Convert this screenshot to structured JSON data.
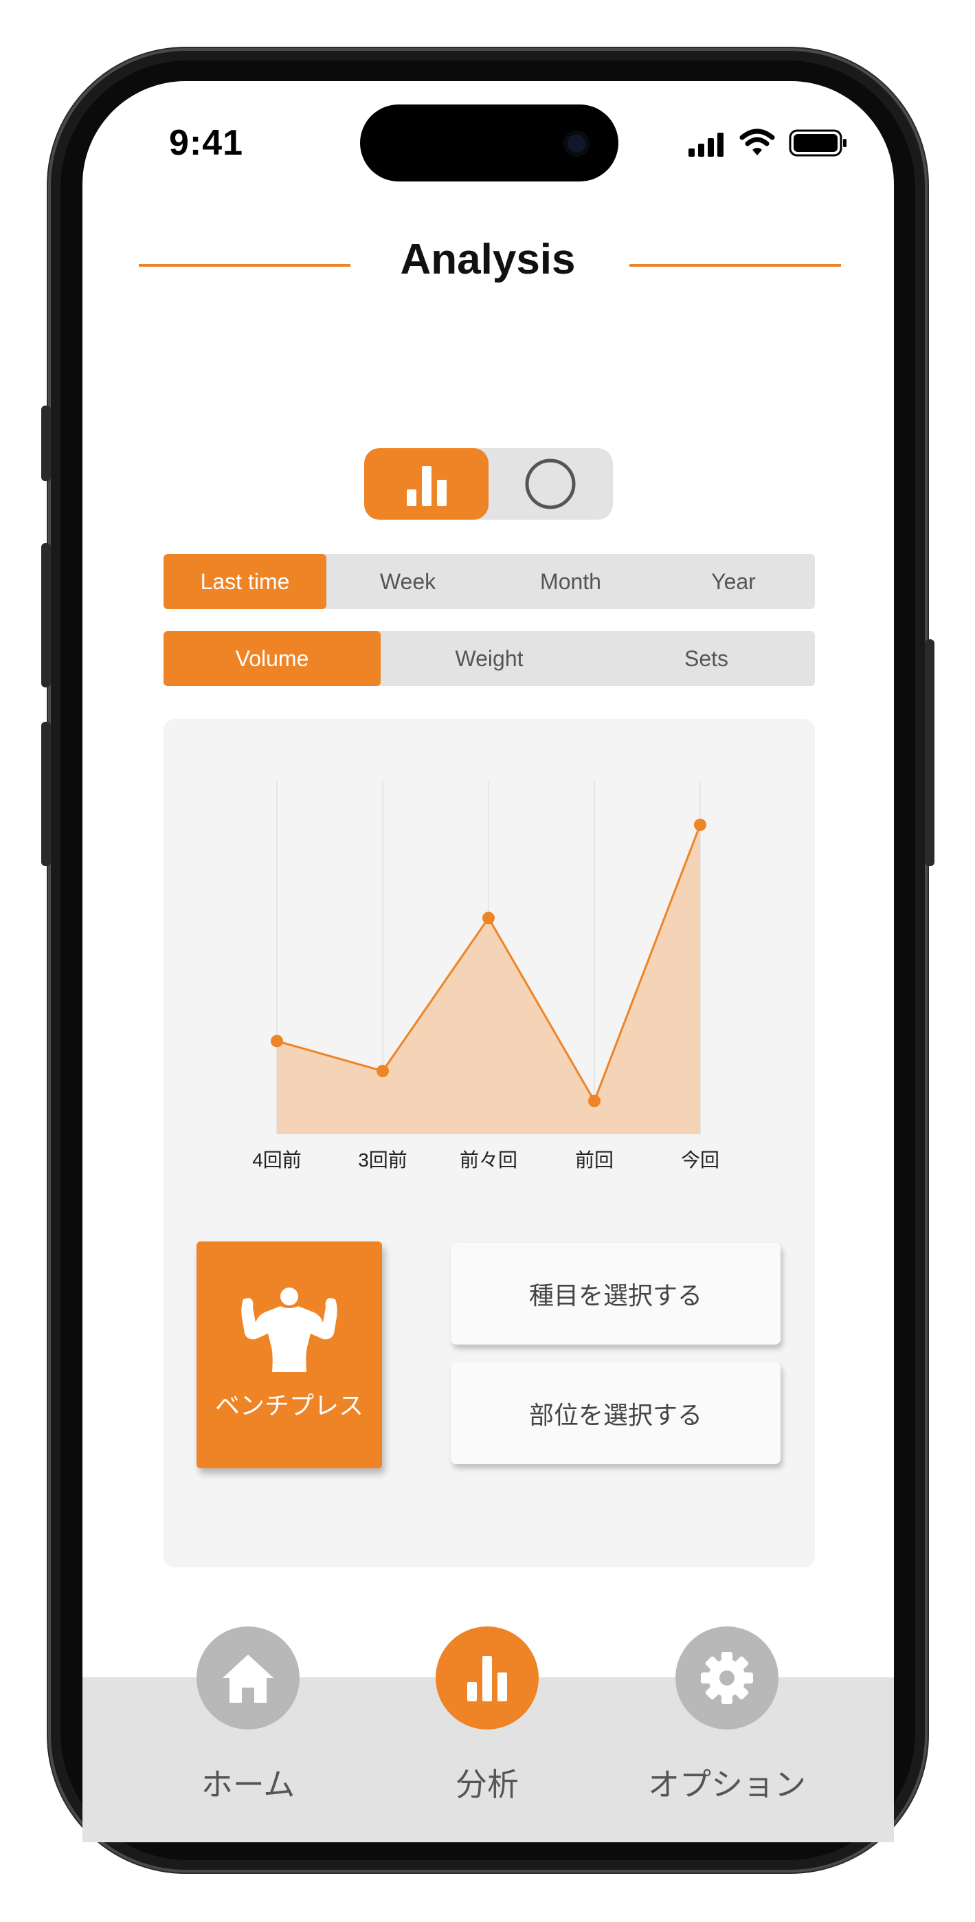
{
  "status": {
    "time": "9:41"
  },
  "header": {
    "title": "Analysis"
  },
  "view_toggle": {
    "options": [
      "bar-chart-icon",
      "circle-icon"
    ],
    "selected": 0
  },
  "period_tabs": {
    "items": [
      "Last time",
      "Week",
      "Month",
      "Year"
    ],
    "selected": 0
  },
  "metric_tabs": {
    "items": [
      "Volume",
      "Weight",
      "Sets"
    ],
    "selected": 0
  },
  "chart_data": {
    "type": "area",
    "categories": [
      "4回前",
      "3回前",
      "前々回",
      "前回",
      "今回"
    ],
    "values": [
      28,
      19,
      65,
      10,
      93
    ],
    "ylim": [
      0,
      100
    ],
    "grid": true,
    "color": "#ee8426",
    "fill": "#f5d3b6"
  },
  "exercise": {
    "label": "ベンチプレス",
    "icon": "flexing-man-icon"
  },
  "actions": {
    "select_exercise": "種目を選択する",
    "select_part": "部位を選択する"
  },
  "tabbar": {
    "items": [
      {
        "label": "ホーム",
        "icon": "home-icon"
      },
      {
        "label": "分析",
        "icon": "bar-chart-icon"
      },
      {
        "label": "オプション",
        "icon": "gear-icon"
      }
    ],
    "selected": 1
  },
  "colors": {
    "accent": "#ee8426",
    "segment_bg": "#e3e3e3",
    "card_bg": "#f4f4f4"
  }
}
